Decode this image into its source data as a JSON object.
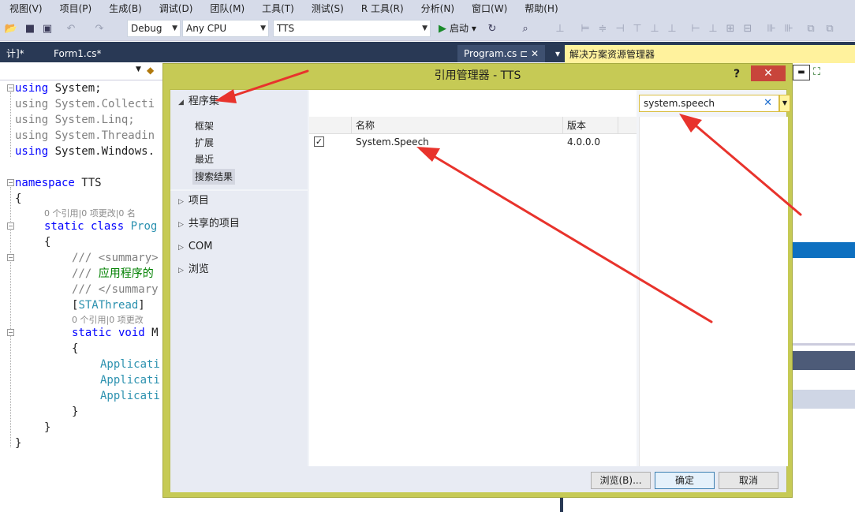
{
  "menu": [
    "视图(V)",
    "项目(P)",
    "生成(B)",
    "调试(D)",
    "团队(M)",
    "工具(T)",
    "测试(S)",
    "R 工具(R)",
    "分析(N)",
    "窗口(W)",
    "帮助(H)"
  ],
  "toolbar": {
    "config": "Debug",
    "platform": "Any CPU",
    "project": "TTS",
    "start_label": "启动"
  },
  "tabs": {
    "tab1": "计]*",
    "tab2": "Form1.cs*",
    "tab3": "Program.cs"
  },
  "solution_explorer_title": "解决方案资源管理器",
  "code": {
    "l1a": "using",
    "l1b": " System;",
    "l2": "using System.Collecti",
    "l3": "using System.Linq;",
    "l4": "using System.Threadin",
    "l5a": "using",
    "l5b": " System.Windows.",
    "ns_kw": "namespace",
    "ns_name": " TTS",
    "brace_open": "{",
    "brace_close": "}",
    "lens1": "0 个引用|0 项更改|0 名",
    "cls_kw": "static class",
    "cls_name": " Prog",
    "c1": "/// <summary>",
    "c2a": "/// ",
    "c2b": "应用程序的",
    "c3": "/// </summary",
    "attr_open": "[",
    "attr": "STAThread",
    "attr_close": "]",
    "lens2": "0 个引用|0 项更改",
    "m_kw": "static void",
    "m_name": " M",
    "app1": "Applicati",
    "app2": "Applicati",
    "app3": "Applicati"
  },
  "dialog": {
    "title": "引用管理器 - TTS",
    "help": "?",
    "close": "✕",
    "nav_header": "程序集",
    "nav_sub": [
      "框架",
      "扩展",
      "最近",
      "搜索结果"
    ],
    "nav_groups": [
      "项目",
      "共享的项目",
      "COM",
      "浏览"
    ],
    "col_name": "名称",
    "col_version": "版本",
    "row_name": "System.Speech",
    "row_version": "4.0.0.0",
    "row_checked": true,
    "search_value": "system.speech",
    "browse_btn": "浏览(B)...",
    "ok_btn": "确定",
    "cancel_btn": "取消"
  },
  "colors": {
    "vs_blue": "#293955",
    "title_yellow": "#fff29d",
    "dialog_frame": "#c6ca55",
    "annotation_red": "#e8332c"
  }
}
